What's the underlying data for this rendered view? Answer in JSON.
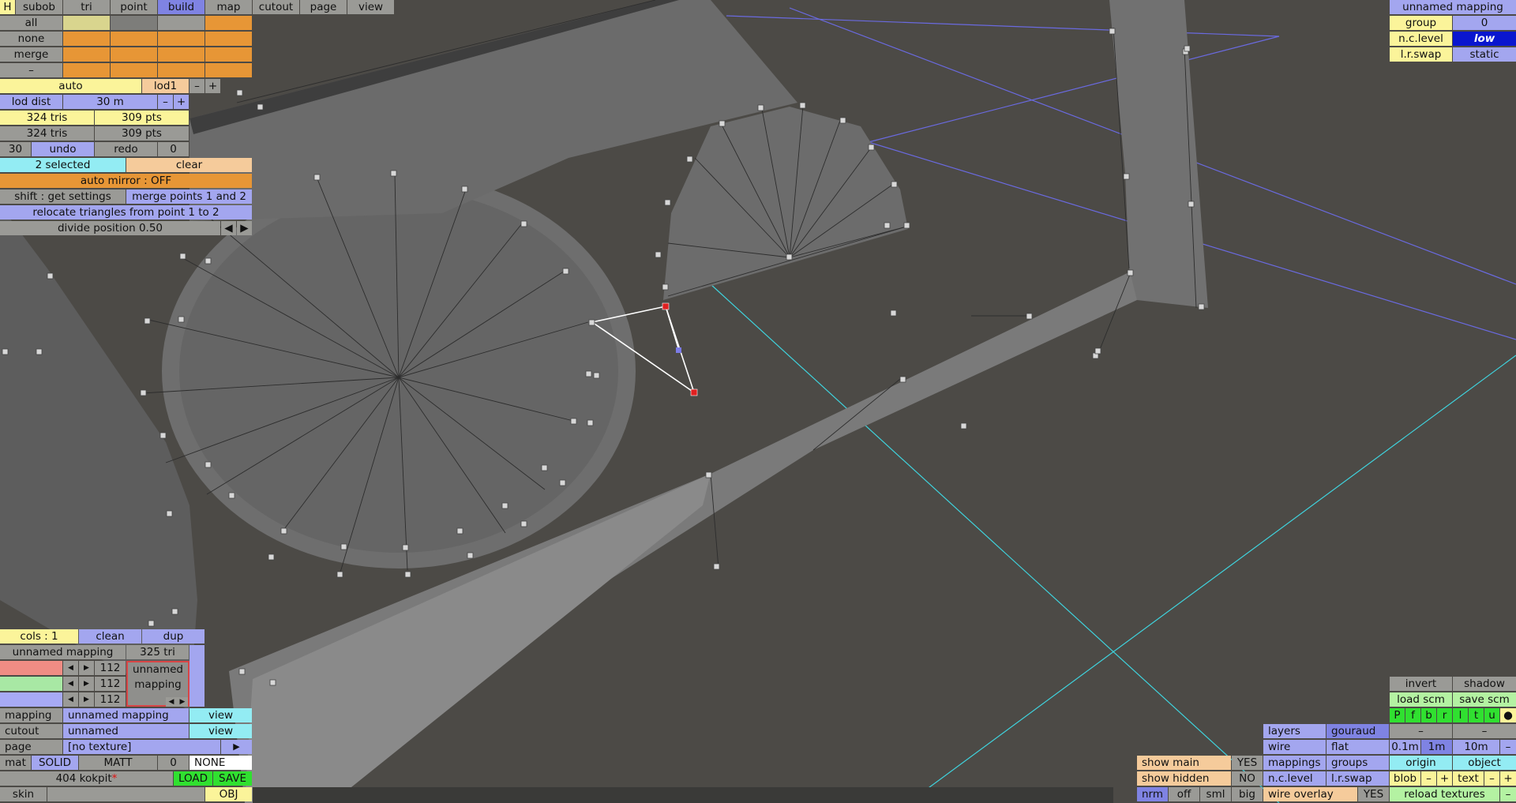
{
  "menu": {
    "h": "H",
    "tabs": [
      "subob",
      "tri",
      "point",
      "build",
      "map",
      "cutout",
      "page",
      "view"
    ]
  },
  "sel": {
    "all": "all",
    "none": "none",
    "merge": "merge",
    "dash": "–"
  },
  "lod": {
    "auto": "auto",
    "lod1": "lod1",
    "minus": "–",
    "plus": "+",
    "dist_label": "lod dist",
    "dist_value": "30 m",
    "dist_minus": "–",
    "dist_plus": "+"
  },
  "stats": {
    "tris1": "324 tris",
    "pts1": "309 pts",
    "tris2": "324 tris",
    "pts2": "309 pts"
  },
  "undo": {
    "count": "30",
    "undo": "undo",
    "redo": "redo",
    "redo_count": "0"
  },
  "selection": {
    "selected": "2 selected",
    "clear": "clear",
    "auto_mirror": "auto mirror : OFF",
    "shift": "shift : get settings",
    "merge_points": "merge points 1 and 2",
    "relocate": "relocate triangles from point 1 to 2",
    "divide": "divide position 0.50"
  },
  "colpanel": {
    "cols": "cols : 1",
    "clean": "clean",
    "dup": "dup",
    "mapping_name": "unnamed mapping",
    "tri_count": "325 tri",
    "r": "112",
    "g": "112",
    "b": "112",
    "preview_line1": "unnamed",
    "preview_line2": "mapping"
  },
  "props": {
    "mapping_label": "mapping",
    "mapping_value": "unnamed mapping",
    "view1": "view",
    "cutout_label": "cutout",
    "cutout_value": "unnamed",
    "view2": "view",
    "page_label": "page",
    "page_value": "[no texture]",
    "mat": "mat",
    "solid": "SOLID",
    "matt": "MATT",
    "zero": "0",
    "none": "NONE",
    "file": "404 kokpit",
    "load": "LOAD",
    "save": "SAVE",
    "skin": "skin",
    "obj": "OBJ"
  },
  "topright": {
    "title": "unnamed mapping",
    "group_label": "group",
    "group_value": "0",
    "nc_label": "n.c.level",
    "nc_value": "low",
    "lr_label": "l.r.swap",
    "lr_value": "static"
  },
  "br": {
    "invert": "invert",
    "shadow": "shadow",
    "load_scm": "load scm",
    "save_scm": "save scm",
    "views": [
      "P",
      "f",
      "b",
      "r",
      "l",
      "t",
      "u",
      "●"
    ],
    "layers": "layers",
    "gouraud": "gouraud",
    "dash1": "–",
    "dash2": "–",
    "wire": "wire",
    "flat": "flat",
    "z1": "0.1m",
    "z2": "1m",
    "z3": "10m",
    "zminus": "–",
    "show_main": "show main",
    "show_main_v": "YES",
    "mappings": "mappings",
    "groups": "groups",
    "origin": "origin",
    "object": "object",
    "show_hidden": "show hidden",
    "show_hidden_v": "NO",
    "ncl": "n.c.level",
    "lrs": "l.r.swap",
    "blob": "blob",
    "bm": "–",
    "bp": "+",
    "text": "text",
    "tm": "–",
    "tp": "+",
    "nrm": "nrm",
    "off": "off",
    "sml": "sml",
    "big": "big",
    "wire_overlay": "wire overlay",
    "wo_v": "YES",
    "reload": "reload textures",
    "rm": "–"
  }
}
